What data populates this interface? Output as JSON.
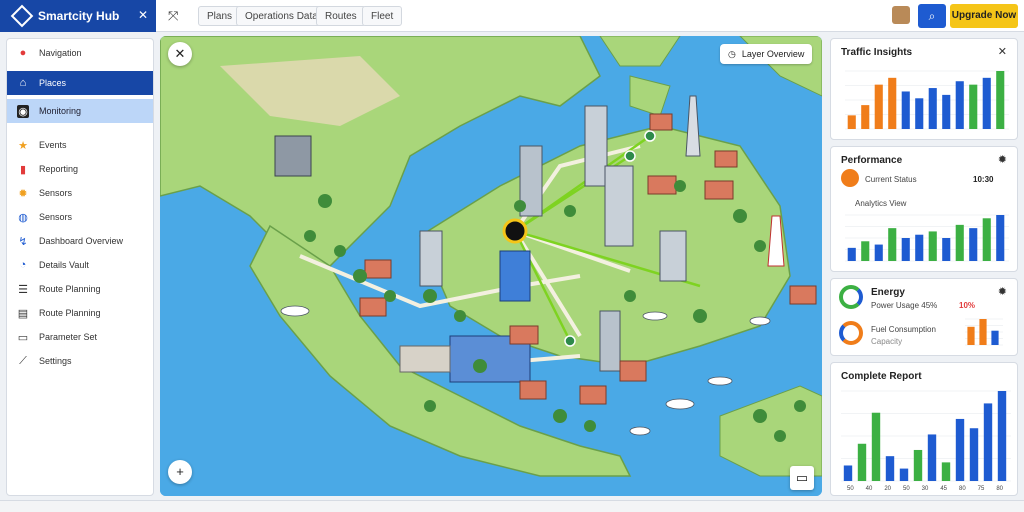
{
  "app": {
    "title": "Smartcity Hub"
  },
  "toolbar": {
    "buttons": [
      {
        "label": "Plans"
      },
      {
        "label": "Operations Data"
      },
      {
        "label": "Routes"
      },
      {
        "label": "Fleet"
      }
    ],
    "cta_label": "Upgrade Now"
  },
  "sidebar": {
    "items": [
      {
        "label": "Navigation",
        "icon": "pin-icon"
      },
      {
        "label": "Places",
        "icon": "home-icon"
      },
      {
        "label": "Monitoring",
        "icon": "camera-icon"
      },
      {
        "label": "Events",
        "icon": "star-icon"
      },
      {
        "label": "Reporting",
        "icon": "chart-icon"
      },
      {
        "label": "Sensors",
        "icon": "gear-icon"
      },
      {
        "label": "Sensors",
        "icon": "globe-icon"
      },
      {
        "label": "Dashboard Overview",
        "icon": "map-icon"
      },
      {
        "label": "Details Vault",
        "icon": "info-icon"
      },
      {
        "label": "Route Planning",
        "icon": "list-icon"
      },
      {
        "label": "Route Planning",
        "icon": "file-icon"
      },
      {
        "label": "Parameter Set",
        "icon": "pencil-icon"
      },
      {
        "label": "Settings",
        "icon": "settings-icon"
      }
    ]
  },
  "map": {
    "filter_label": "Layer Overview"
  },
  "panels": {
    "traffic": {
      "title": "Traffic Insights",
      "chart_data": {
        "type": "bar",
        "values": [
          8,
          14,
          26,
          30,
          22,
          18,
          24,
          20,
          28,
          26,
          30,
          34
        ]
      }
    },
    "metrics": {
      "title": "Performance",
      "stat_label": "Current Status",
      "stat_value": "10:30",
      "subtitle": "Analytics View",
      "chart_data": {
        "type": "bar",
        "values": [
          8,
          12,
          10,
          20,
          14,
          16,
          18,
          14,
          22,
          20,
          26,
          28
        ]
      }
    },
    "energy": {
      "title": "Energy",
      "label1": "Power Usage 45%",
      "label2": "Fuel Consumption",
      "label3": "Capacity",
      "badge": "10%",
      "chart_data": {
        "type": "bar",
        "values": [
          28,
          40,
          22
        ]
      }
    },
    "report": {
      "title": "Complete Report",
      "chart_data": {
        "type": "bar",
        "categories": [
          "50",
          "40",
          "20",
          "50",
          "30",
          "45",
          "80",
          "75",
          "80"
        ],
        "values": [
          10,
          24,
          44,
          16,
          8,
          20,
          30,
          12,
          40,
          34,
          50,
          58
        ]
      }
    }
  },
  "colors": {
    "brand": "#1747a6",
    "accent": "#f5c518",
    "bar_blue": "#1e5bd1",
    "bar_green": "#3cb043",
    "bar_orange": "#f07d1a",
    "water": "#4aa9e6",
    "land": "#a9d67a"
  }
}
